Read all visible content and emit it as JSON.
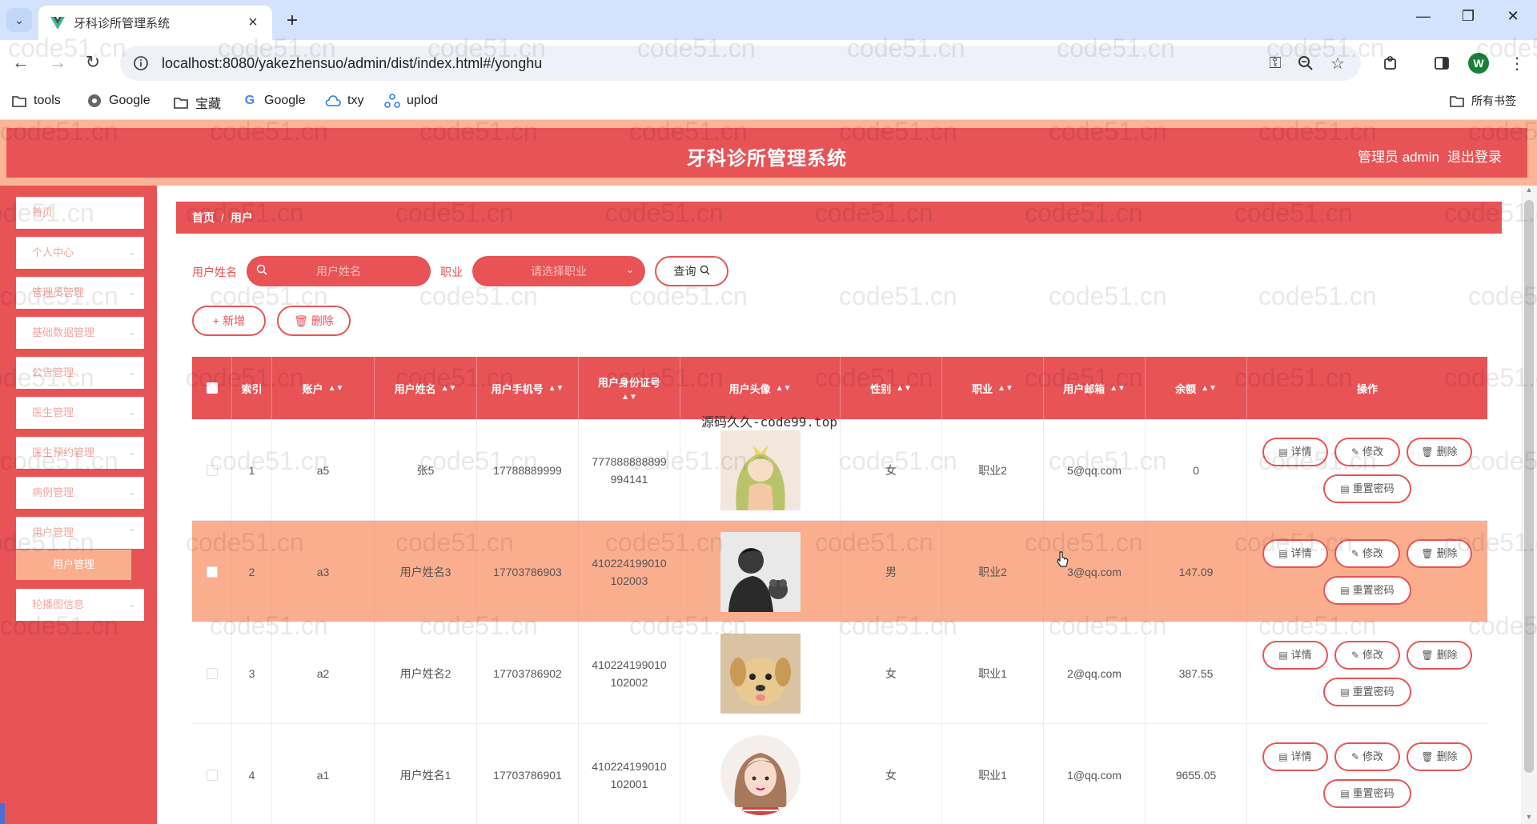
{
  "browser": {
    "tab_title": "牙科诊所管理系统",
    "url": "localhost:8080/yakezhensuo/admin/dist/index.html#/yonghu",
    "profile_initial": "W",
    "bookmarks": [
      "tools",
      "Google",
      "宝藏",
      "Google",
      "txy",
      "uplod"
    ],
    "all_bookmarks": "所有书签"
  },
  "header": {
    "title": "牙科诊所管理系统",
    "admin": "管理员 admin",
    "logout": "退出登录"
  },
  "sidebar": {
    "items": [
      {
        "label": "首页",
        "has_arrow": false
      },
      {
        "label": "个人中心",
        "has_arrow": true
      },
      {
        "label": "管理员管理",
        "has_arrow": true
      },
      {
        "label": "基础数据管理",
        "has_arrow": true
      },
      {
        "label": "公告管理",
        "has_arrow": true
      },
      {
        "label": "医生管理",
        "has_arrow": true
      },
      {
        "label": "医生预约管理",
        "has_arrow": true
      },
      {
        "label": "病例管理",
        "has_arrow": true
      },
      {
        "label": "用户管理",
        "has_arrow": true
      },
      {
        "label": "轮播图信息",
        "has_arrow": true
      }
    ],
    "active_sub": "用户管理"
  },
  "breadcrumb": [
    "首页",
    "用户"
  ],
  "filters": {
    "name_label": "用户姓名",
    "name_placeholder": "用户姓名",
    "job_label": "职业",
    "job_placeholder": "请选择职业",
    "query": "查询"
  },
  "actions": {
    "add": "新增",
    "delete": "删除"
  },
  "table": {
    "columns": [
      "索引",
      "账户",
      "用户姓名",
      "用户手机号",
      "用户身份证号",
      "用户头像",
      "性别",
      "职业",
      "用户邮箱",
      "余额",
      "操作"
    ],
    "rows": [
      {
        "index": "1",
        "account": "a5",
        "name": "张5",
        "phone": "17788889999",
        "id_1": "777888888899",
        "id_2": "994141",
        "avatar": "girl-green-hair",
        "gender": "女",
        "job": "职业2",
        "email": "5@qq.com",
        "balance": "0"
      },
      {
        "index": "2",
        "account": "a3",
        "name": "用户姓名3",
        "phone": "17703786903",
        "id_1": "410224199010",
        "id_2": "102003",
        "avatar": "man-bw",
        "gender": "男",
        "job": "职业2",
        "email": "3@qq.com",
        "balance": "147.09"
      },
      {
        "index": "3",
        "account": "a2",
        "name": "用户姓名2",
        "phone": "17703786902",
        "id_1": "410224199010",
        "id_2": "102002",
        "avatar": "puppy",
        "gender": "女",
        "job": "职业1",
        "email": "2@qq.com",
        "balance": "387.55"
      },
      {
        "index": "4",
        "account": "a1",
        "name": "用户姓名1",
        "phone": "17703786901",
        "id_1": "410224199010",
        "id_2": "102001",
        "avatar": "girl-illustration",
        "gender": "女",
        "job": "职业1",
        "email": "1@qq.com",
        "balance": "9655.05"
      }
    ],
    "op_labels": {
      "detail": "详情",
      "edit": "修改",
      "delete": "删除",
      "reset": "重置密码"
    }
  },
  "overlay_text": "源码久久-code99.top",
  "watermark": "code51.cn",
  "colors": {
    "primary": "#e85356",
    "accent": "#fbae8e",
    "header_border": "#fbb496"
  }
}
